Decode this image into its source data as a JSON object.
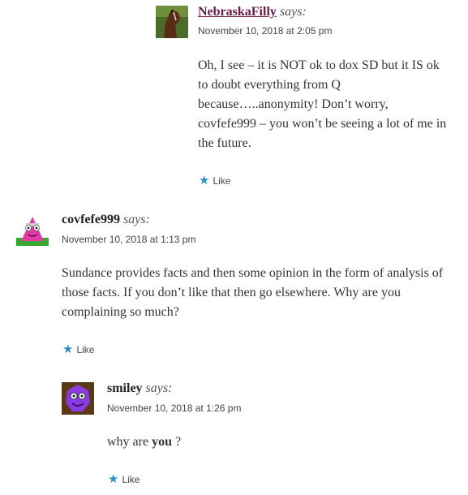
{
  "comments": [
    {
      "author": "NebraskaFilly",
      "says": "says:",
      "date": "November 10, 2018 at 2:05 pm",
      "text": "Oh, I see – it is NOT ok to dox SD but it IS ok to doubt everything from Q because…..anonymity! Don’t worry, covfefe999 – you won’t be seeing a lot of me in the future.",
      "like": "Like",
      "avatar": "horse-avatar"
    },
    {
      "author": "covfefe999",
      "says": "says:",
      "date": "November 10, 2018 at 1:13 pm",
      "text": "Sundance provides facts and then some opinion in the form of analysis of those facts. If you don’t like that then go elsewhere. Why are you complaining so much?",
      "like": "Like",
      "avatar": "pink-monster-avatar"
    },
    {
      "author": "smiley",
      "says": "says:",
      "date": "November 10, 2018 at 1:26 pm",
      "text_before": "why are ",
      "text_bold": "you",
      "text_after": " ?",
      "like": "Like",
      "avatar": "purple-monster-avatar"
    }
  ],
  "colors": {
    "like_star": "#2b90c8",
    "author_link": "#6b1a4a"
  },
  "icons": {
    "like": "star-icon"
  }
}
